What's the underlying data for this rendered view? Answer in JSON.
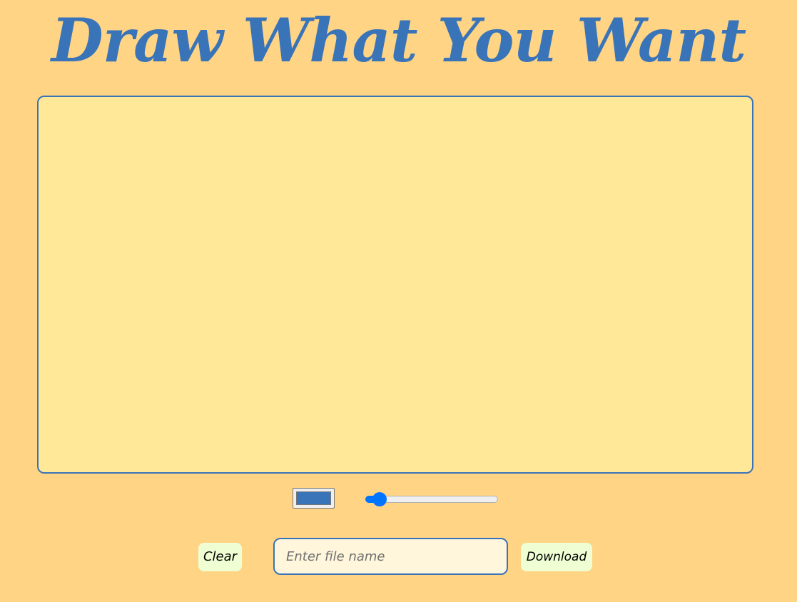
{
  "title": "Draw What You Want",
  "canvas": {
    "background": "#ffe897",
    "border_color": "#3a74b8"
  },
  "controls": {
    "stroke_color": "#3a74b8",
    "brush_size_fraction": 0.06
  },
  "actions": {
    "clear_label": "Clear",
    "filename_placeholder": "Enter file name",
    "filename_value": "",
    "download_label": "Download"
  },
  "colors": {
    "page_background": "#ffd485",
    "accent": "#3a74b8",
    "button_background": "#efffd3",
    "slider_accent": "#0075ff"
  }
}
